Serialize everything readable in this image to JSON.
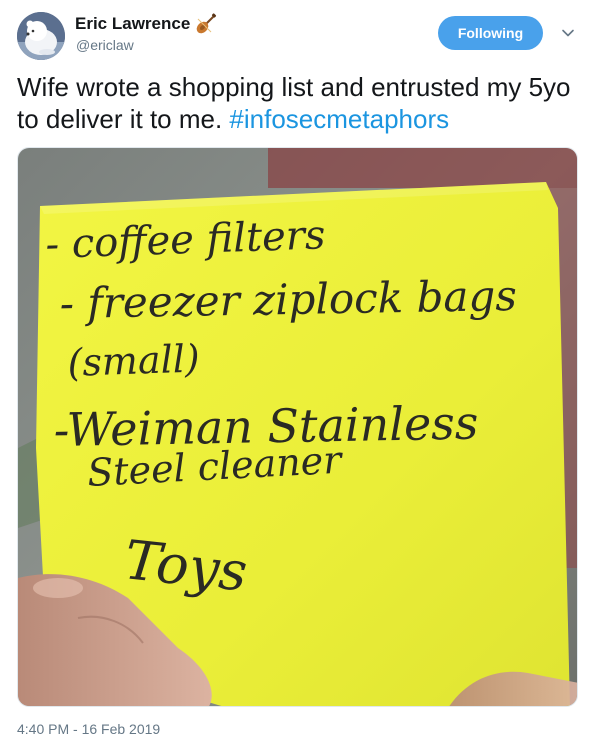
{
  "author": {
    "display_name": "Eric Lawrence",
    "handle": "@ericlaw",
    "name_emoji": "violin-icon",
    "avatar": "snow-polar-bear-avatar"
  },
  "follow_button": {
    "label": "Following",
    "color": "#49a1eb"
  },
  "menu": {
    "icon": "chevron-down-icon"
  },
  "tweet": {
    "text": "Wife wrote a shopping list and entrusted my 5yo to deliver it to me. ",
    "hashtag": "#infosecmetaphors",
    "link_color": "#1b95e0"
  },
  "photo": {
    "note_lines": [
      "- coffee filters",
      "- freezer ziplock bags",
      "(small)",
      "-Weiman Stainless",
      "Steel cleaner",
      "Toys"
    ],
    "note_color": "#eef03c"
  },
  "footer": {
    "timestamp": "4:40 PM - 16 Feb 2019"
  }
}
